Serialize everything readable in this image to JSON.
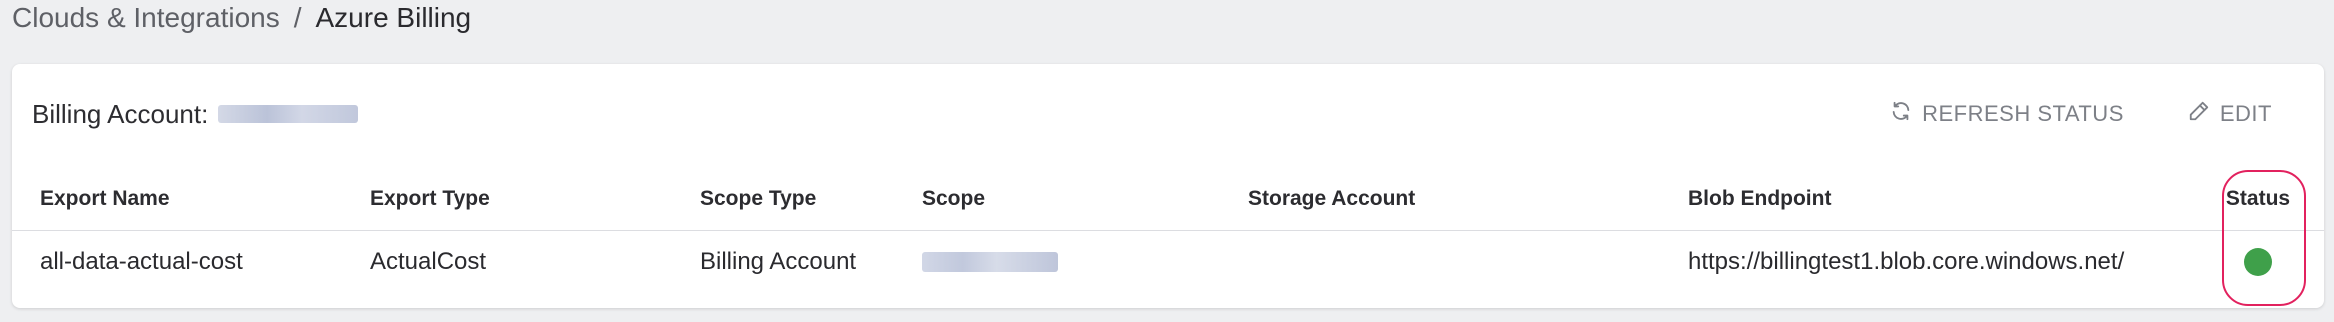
{
  "breadcrumb": {
    "parent": "Clouds & Integrations",
    "separator": "/",
    "current": "Azure Billing"
  },
  "card": {
    "billing_label": "Billing Account:",
    "actions": {
      "refresh_label": "REFRESH STATUS",
      "edit_label": "EDIT"
    }
  },
  "table": {
    "columns": [
      "Export Name",
      "Export Type",
      "Scope Type",
      "Scope",
      "Storage Account",
      "Blob Endpoint",
      "Status"
    ],
    "rows": [
      {
        "export_name": "all-data-actual-cost",
        "export_type": "ActualCost",
        "scope_type": "Billing Account",
        "storage_account": "",
        "blob_endpoint": "https://billingtest1.blob.core.windows.net/",
        "status": "ok"
      }
    ]
  },
  "colors": {
    "status_ok": "#3fa04a",
    "highlight": "#e2215e"
  }
}
